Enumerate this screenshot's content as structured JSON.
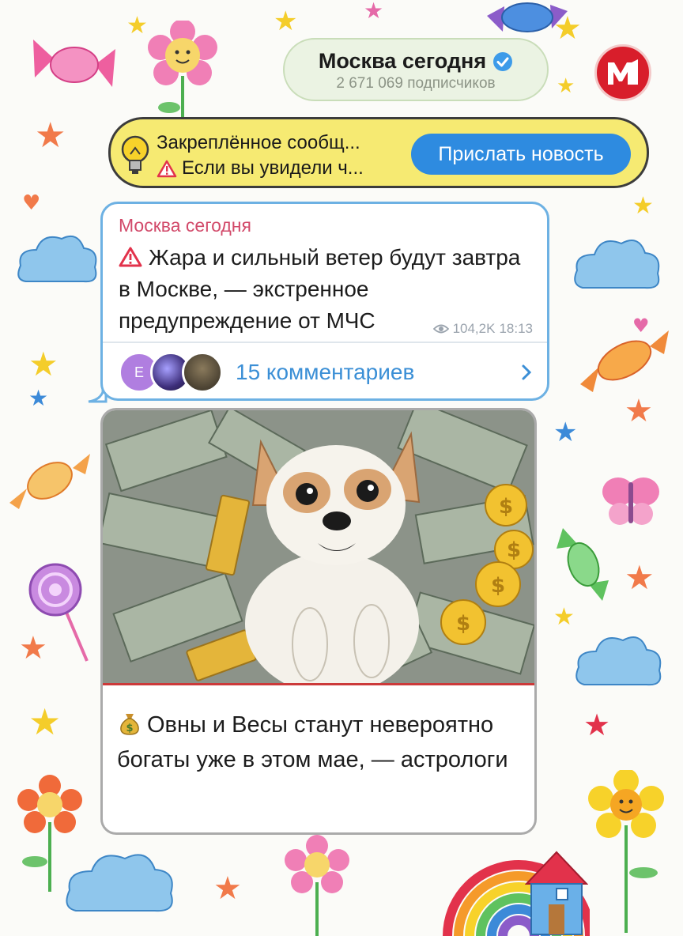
{
  "channel": {
    "name": "Москва сегодня",
    "subscribers": "2 671 069 подписчиков",
    "logo": "М"
  },
  "pinned": {
    "title": "Закреплённое сообщ...",
    "text": "Если вы увидели ч...",
    "button": "Прислать новость"
  },
  "message": {
    "author": "Москва сегодня",
    "text": "Жара и сильный ветер будут завтра в Москве, — экстренное предупреждение от МЧС",
    "views": "104,2K",
    "time": "18:13",
    "avatar_letter": "E",
    "comments": "15 комментариев"
  },
  "post": {
    "text": "Овны и Весы станут невероятно богаты уже в этом мае, — астрологи"
  },
  "colors": {
    "accent": "#2e8be0",
    "author": "#d24a6a",
    "pinned_bg": "#f6ea72",
    "logo": "#d81e2b"
  }
}
